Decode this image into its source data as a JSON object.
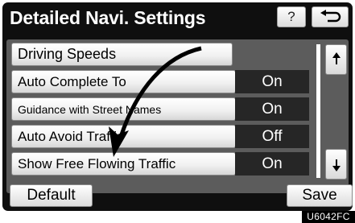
{
  "header": {
    "title": "Detailed Navi. Settings",
    "help_label": "?",
    "help_icon": "question-mark-icon",
    "back_icon": "return-arrow-icon"
  },
  "rows": [
    {
      "label": "Driving Speeds",
      "value": null
    },
    {
      "label": "Auto Complete To",
      "value": "On"
    },
    {
      "label": "Guidance with Street Names",
      "value": "On"
    },
    {
      "label": "Auto Avoid Traffic",
      "value": "Off"
    },
    {
      "label": "Show Free Flowing Traffic",
      "value": "On"
    }
  ],
  "scroll": {
    "up_icon": "scroll-up-icon",
    "down_icon": "scroll-down-icon"
  },
  "footer": {
    "default_label": "Default",
    "save_label": "Save"
  },
  "figure_code": "U6042FC",
  "colors": {
    "background": "#0f0f0f",
    "panel": "#5c5c5c",
    "status_box": "#262626",
    "button": "#f1f1f1"
  }
}
